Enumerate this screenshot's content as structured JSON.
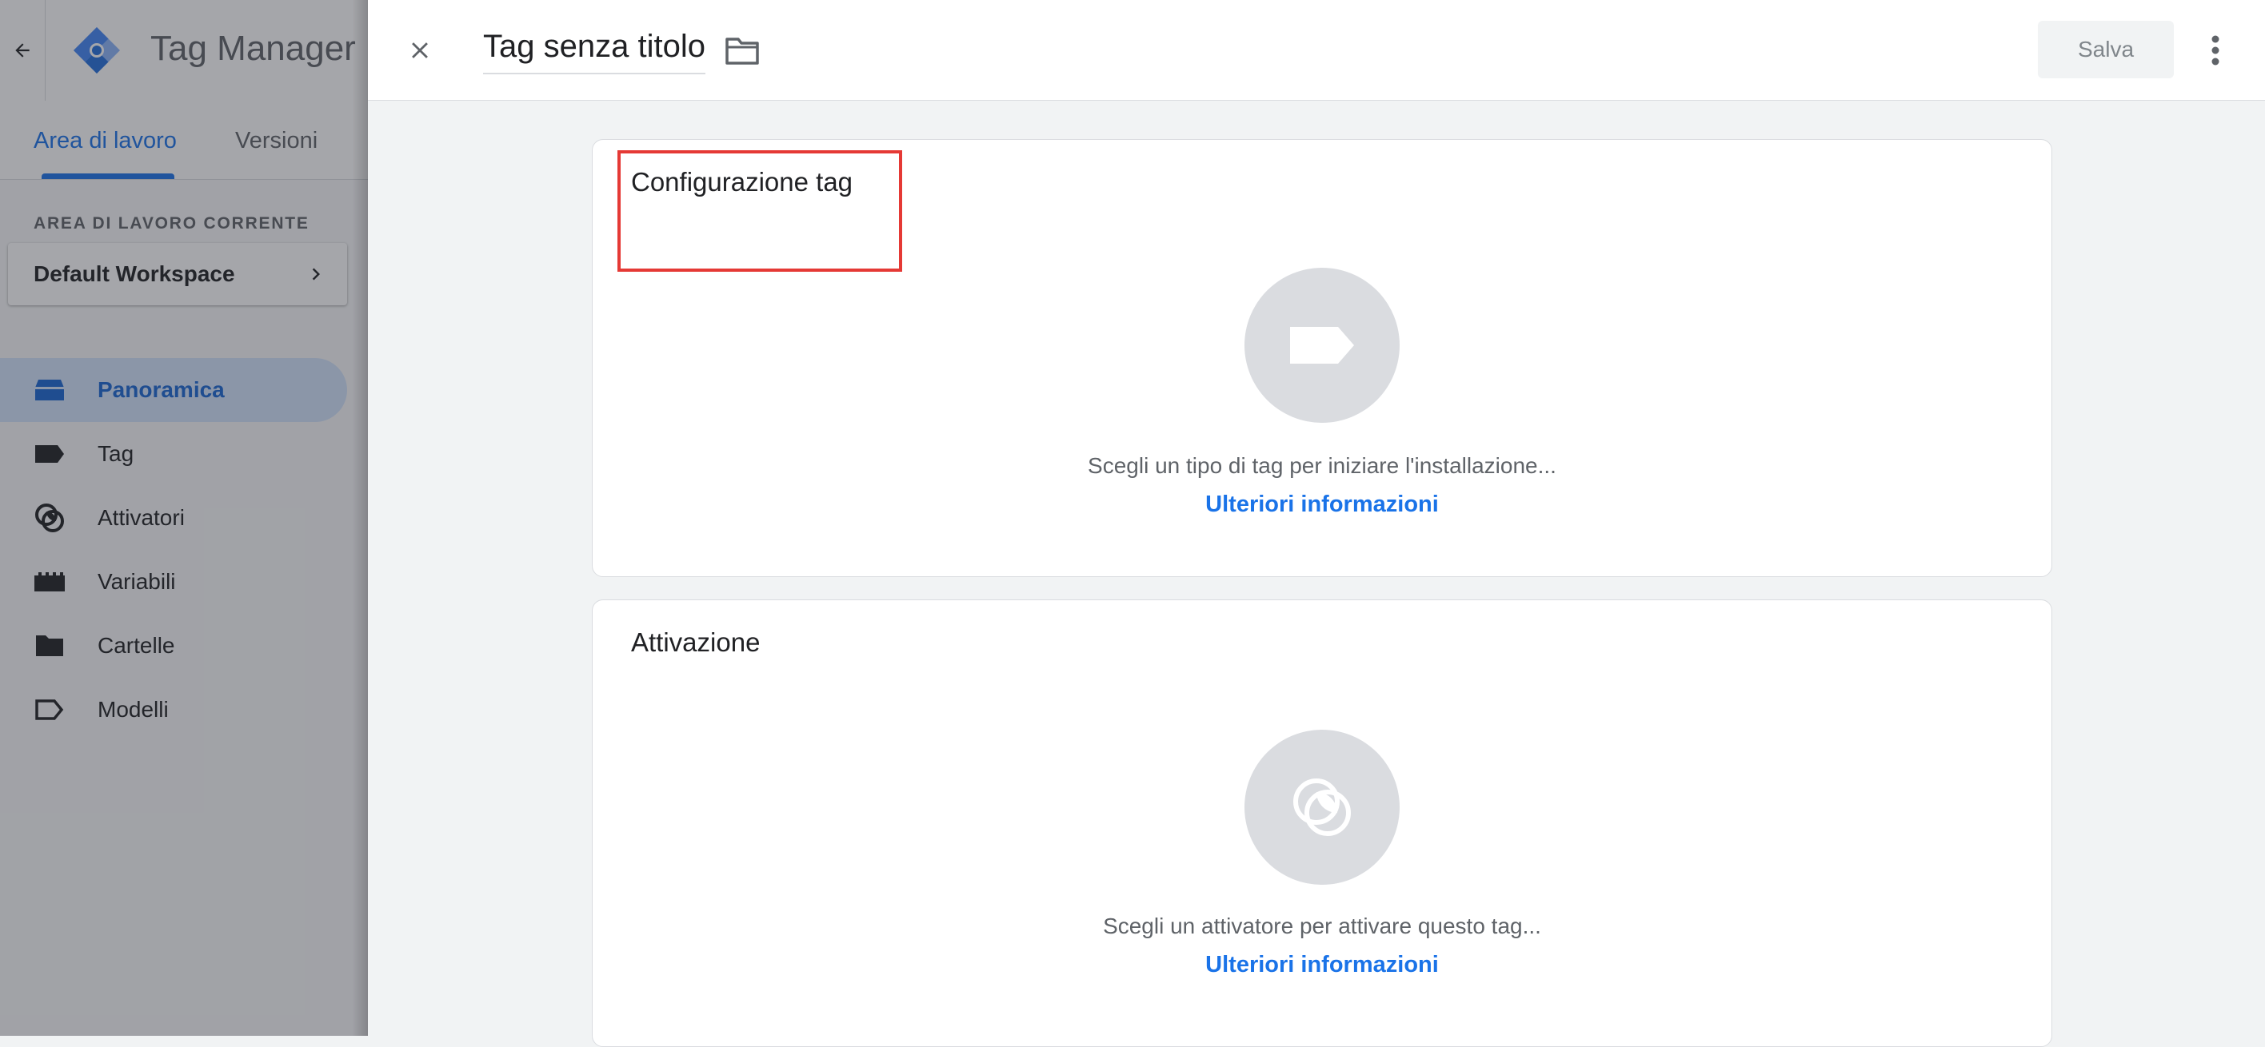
{
  "app": {
    "title": "Tag Manager"
  },
  "sidebar": {
    "tabs": [
      {
        "label": "Area di lavoro",
        "active": true
      },
      {
        "label": "Versioni",
        "active": false
      }
    ],
    "workspace_label": "AREA DI LAVORO CORRENTE",
    "workspace_name": "Default Workspace",
    "items": [
      {
        "label": "Panoramica",
        "icon": "overview-icon",
        "active": true
      },
      {
        "label": "Tag",
        "icon": "tag-icon",
        "active": false
      },
      {
        "label": "Attivatori",
        "icon": "trigger-icon",
        "active": false
      },
      {
        "label": "Variabili",
        "icon": "variables-icon",
        "active": false
      },
      {
        "label": "Cartelle",
        "icon": "folder-icon",
        "active": false
      },
      {
        "label": "Modelli",
        "icon": "template-icon",
        "active": false
      }
    ]
  },
  "editor": {
    "tag_name": "Tag senza titolo",
    "save_label": "Salva",
    "config_card": {
      "title": "Configurazione tag",
      "description": "Scegli un tipo di tag per iniziare l'installazione...",
      "link": "Ulteriori informazioni"
    },
    "trigger_card": {
      "title": "Attivazione",
      "description": "Scegli un attivatore per attivare questo tag...",
      "link": "Ulteriori informazioni"
    }
  },
  "colors": {
    "accent": "#1a73e8",
    "highlight": "#e53935",
    "active_nav_bg": "#d2e3fc",
    "placeholder_circle": "#dadce0"
  }
}
